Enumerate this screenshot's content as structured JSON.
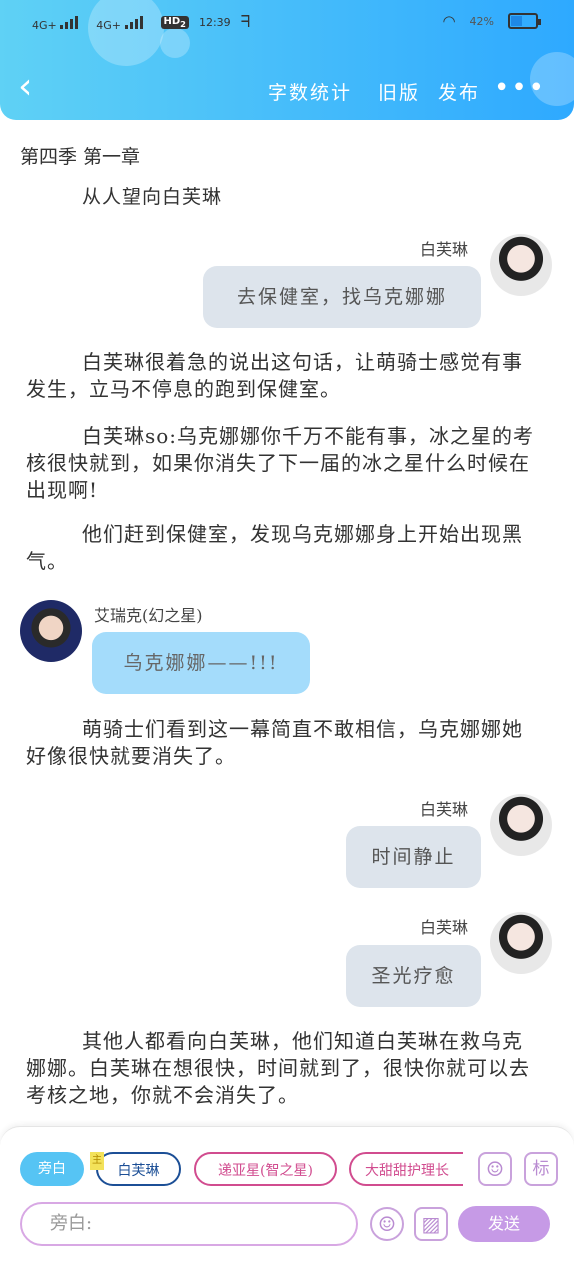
{
  "status_bar": {
    "network1": "4G+",
    "network2": "4G+",
    "hd": "HD",
    "hd_sub": "2",
    "time": "12:39",
    "battery": "42%"
  },
  "header": {
    "nav_items": [
      "字数统计",
      "旧版",
      "发布"
    ]
  },
  "chapter_title": "第四季 第一章",
  "scene_line": "从人望向白芙琳",
  "messages": [
    {
      "speaker": "白芙琳",
      "text": "去保健室，找乌克娜娜"
    },
    {
      "speaker": "艾瑞克(幻之星)",
      "text": "乌克娜娜——!!!"
    },
    {
      "speaker": "白芙琳",
      "text": "时间静止"
    },
    {
      "speaker": "白芙琳",
      "text": "圣光疗愈"
    }
  ],
  "narration": [
    "白芙琳很着急的说出这句话，让萌骑士感觉有事发生，立马不停息的跑到保健室。",
    "白芙琳so:乌克娜娜你千万不能有事，冰之星的考核很快就到，如果你消失了下一届的冰之星什么时候在出现啊!",
    "他们赶到保健室，发现乌克娜娜身上开始出现黑气。",
    "萌骑士们看到这一幕简直不敢相信，乌克娜娜她好像很快就要消失了。",
    "其他人都看向白芙琳，他们知道白芙琳在救乌克娜娜。白芙琳在想很快，时间就到了，很快你就可以去考核之地，你就不会消失了。"
  ],
  "bottom_bar": {
    "role_chips": [
      "旁白",
      "白芙琳",
      "递亚星(智之星)",
      "大甜甜护理长"
    ],
    "small_tag": "主",
    "mark_label": "标",
    "input_placeholder": "旁白:",
    "send_label": "发送"
  },
  "colors": {
    "header_start": "#5fd1f5",
    "header_end": "#2ea9ff",
    "send": "#c69ae6",
    "active_chip": "#56c4f4"
  }
}
